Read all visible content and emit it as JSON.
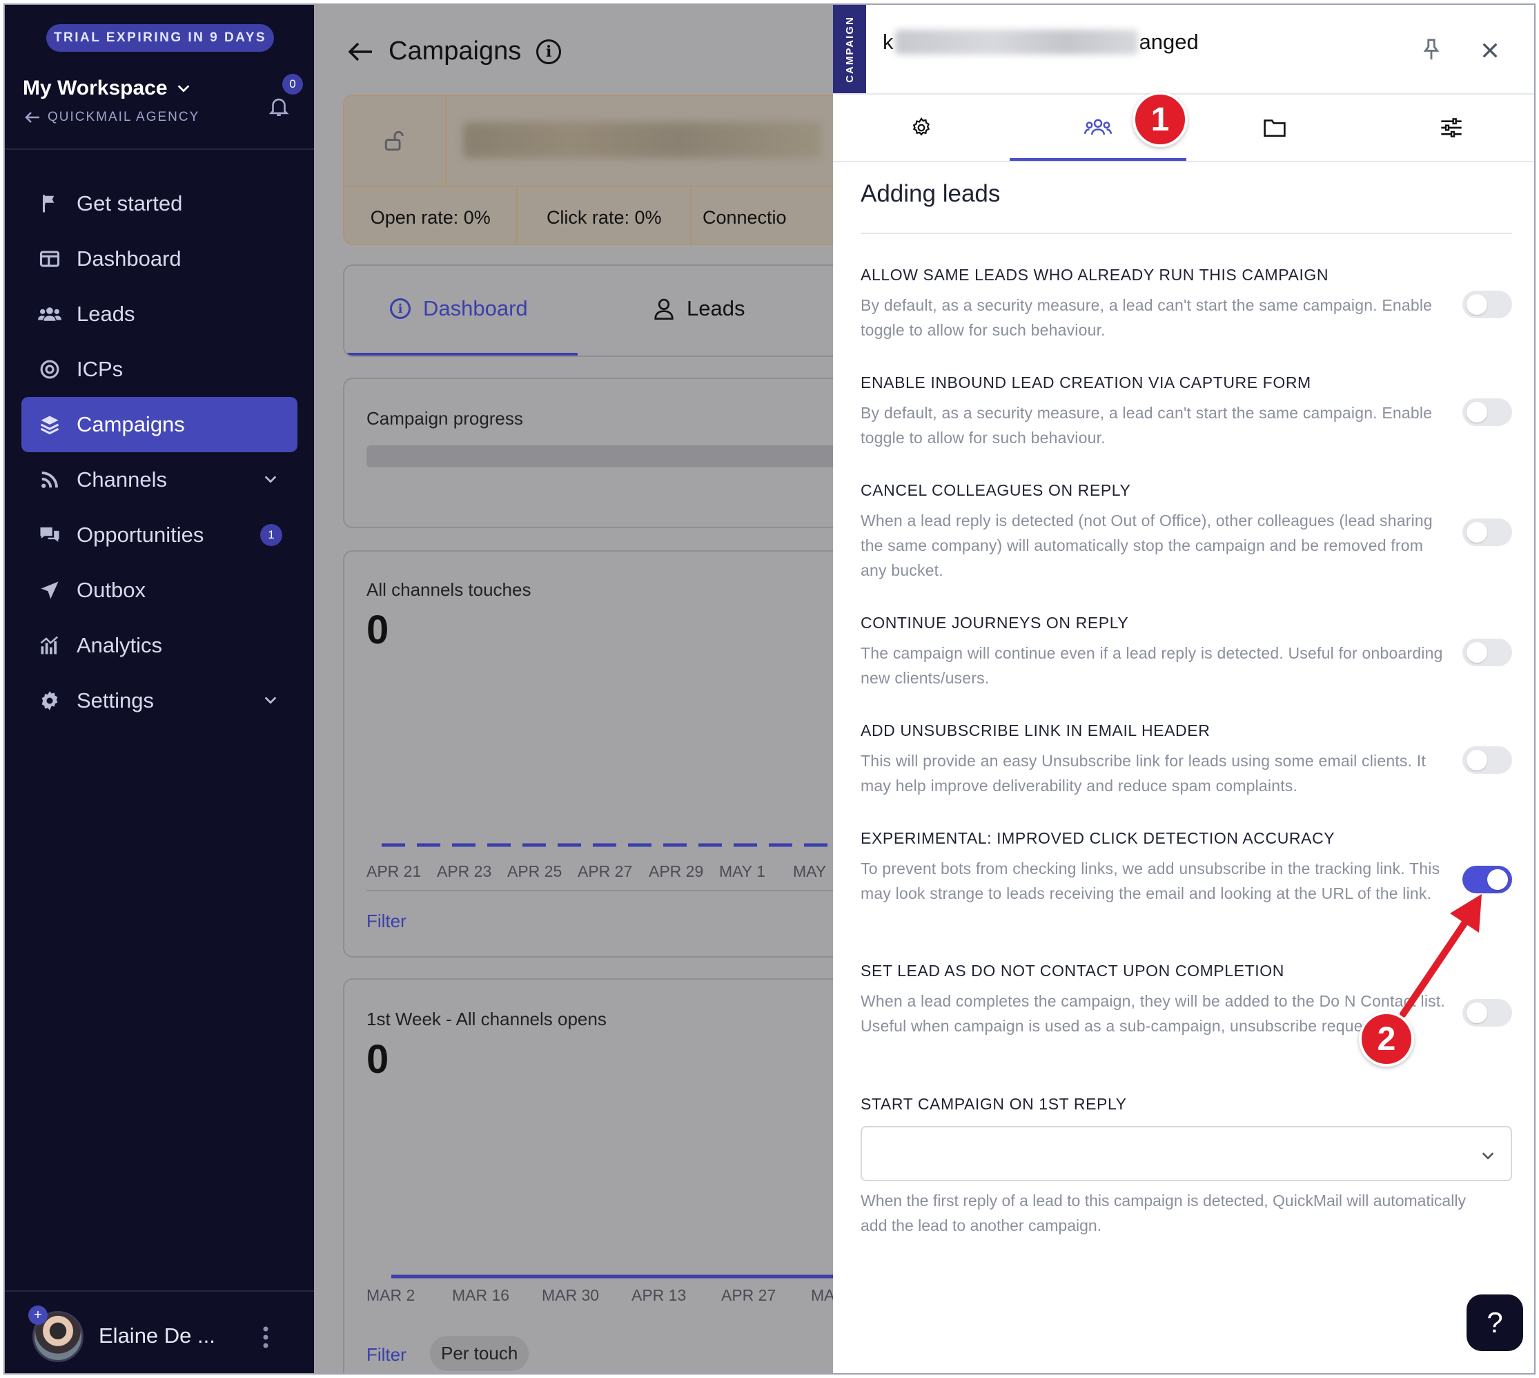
{
  "sidebar": {
    "trial_banner": "TRIAL EXPIRING IN 9 DAYS",
    "workspace_name": "My Workspace",
    "agency_link": "QUICKMAIL AGENCY",
    "notifications_count": "0",
    "nav": [
      {
        "label": "Get started",
        "icon": "flag-icon"
      },
      {
        "label": "Dashboard",
        "icon": "dashboard-icon"
      },
      {
        "label": "Leads",
        "icon": "users-icon"
      },
      {
        "label": "ICPs",
        "icon": "target-icon"
      },
      {
        "label": "Campaigns",
        "icon": "layers-icon",
        "active": true
      },
      {
        "label": "Channels",
        "icon": "rss-icon",
        "expandable": true
      },
      {
        "label": "Opportunities",
        "icon": "chat-icon",
        "badge": "1"
      },
      {
        "label": "Outbox",
        "icon": "send-icon"
      },
      {
        "label": "Analytics",
        "icon": "analytics-icon"
      },
      {
        "label": "Settings",
        "icon": "gear-icon",
        "expandable": true
      }
    ],
    "user_name": "Elaine De ..."
  },
  "main": {
    "title": "Campaigns",
    "stats": {
      "open_rate": "Open rate: 0%",
      "click_rate": "Click rate: 0%",
      "connection": "Connectio"
    },
    "tabs": {
      "dashboard": "Dashboard",
      "leads": "Leads"
    },
    "progress_label": "Campaign progress",
    "touches": {
      "label": "All channels touches",
      "value": "0",
      "ticks": [
        "APR 21",
        "APR 23",
        "APR 25",
        "APR 27",
        "APR 29",
        "MAY 1",
        "MAY"
      ],
      "filter": "Filter"
    },
    "opens": {
      "label": "1st Week - All channels opens",
      "value": "0",
      "ticks": [
        "MAR 2",
        "MAR 16",
        "MAR 30",
        "APR 13",
        "APR 27",
        "MA"
      ],
      "filter": "Filter",
      "per_touch": "Per touch"
    }
  },
  "panel": {
    "tag": "CAMPAIGN",
    "header_prefix": "k",
    "header_suffix": "anged",
    "section_title": "Adding leads",
    "callout_1": "1",
    "callout_2": "2",
    "settings": [
      {
        "title": "ALLOW SAME LEADS WHO ALREADY RUN THIS CAMPAIGN",
        "desc": "By default, as a security measure, a lead can't start the same campaign. Enable toggle to allow for such behaviour.",
        "on": false
      },
      {
        "title": "ENABLE INBOUND LEAD CREATION VIA CAPTURE FORM",
        "desc": "By default, as a security measure, a lead can't start the same campaign. Enable toggle to allow for such behaviour.",
        "on": false
      },
      {
        "title": "CANCEL COLLEAGUES ON REPLY",
        "desc": "When a lead reply is detected (not Out of Office), other colleagues (lead sharing the same company) will automatically stop the campaign and be removed from any bucket.",
        "on": false
      },
      {
        "title": "CONTINUE JOURNEYS ON REPLY",
        "desc": "The campaign will continue even if a lead reply is detected. Useful for onboarding new clients/users.",
        "on": false
      },
      {
        "title": "ADD UNSUBSCRIBE LINK IN EMAIL HEADER",
        "desc": "This will provide an easy Unsubscribe link for leads using some email clients. It may help improve deliverability and reduce spam complaints.",
        "on": false
      },
      {
        "title": "EXPERIMENTAL: IMPROVED CLICK DETECTION ACCURACY",
        "desc": "To prevent bots from checking links, we add unsubscribe in the tracking link. This may look strange to leads receiving the email and looking at the URL of the link.",
        "on": true
      },
      {
        "title": "SET LEAD AS DO NOT CONTACT UPON COMPLETION",
        "desc": "When a lead completes the campaign, they will be added to the Do N Contact list. Useful when campaign is used as a sub-campaign, unsubscribe request.",
        "on": false
      }
    ],
    "start_campaign_title": "START CAMPAIGN ON 1ST REPLY",
    "start_campaign_value": "",
    "start_campaign_desc": "When the first reply of a lead to this campaign is detected, QuickMail will automatically add the lead to another campaign.",
    "help_label": "?"
  },
  "colors": {
    "accent": "#4b4fd6",
    "sidebar_bg": "#0e0e27",
    "callout_red": "#e11d2a"
  }
}
